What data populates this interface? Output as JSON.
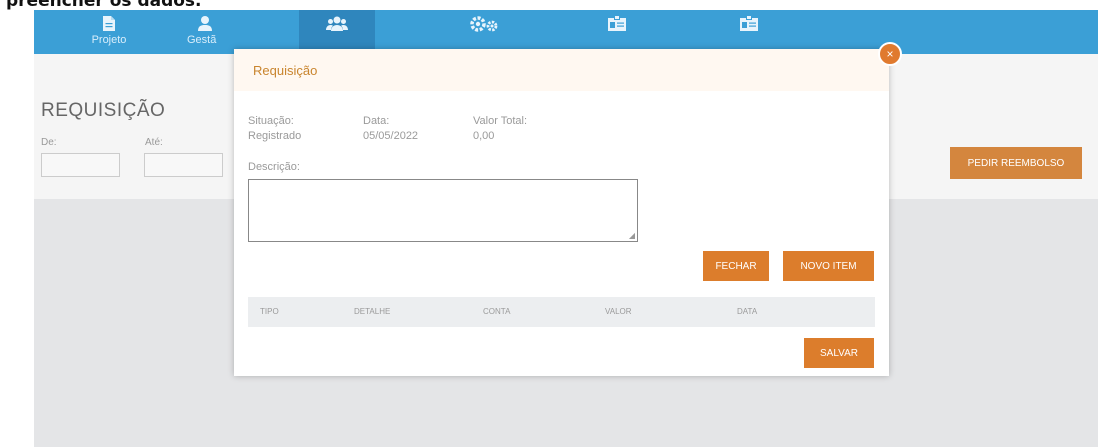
{
  "caption": "preencher os dados.",
  "nav": {
    "items": [
      {
        "label": "Projeto",
        "icon": "document-icon"
      },
      {
        "label": "Gestã",
        "icon": "user-icon"
      },
      {
        "label": "",
        "icon": "group-icon"
      },
      {
        "label": "",
        "icon": "gears-icon"
      },
      {
        "label": "",
        "icon": "id-card-icon"
      },
      {
        "label": "",
        "icon": "id-card-icon"
      }
    ]
  },
  "page": {
    "title": "REQUISIÇÃO",
    "from_label": "De:",
    "to_label": "Até:",
    "reimburse_button": "PEDIR REEMBOLSO"
  },
  "modal": {
    "title": "Requisição",
    "close": "×",
    "situacao_label": "Situação:",
    "situacao_value": "Registrado",
    "data_label": "Data:",
    "data_value": "05/05/2022",
    "valor_label": "Valor Total:",
    "valor_value": "0,00",
    "descricao_label": "Descrição:",
    "fechar_button": "FECHAR",
    "novo_item_button": "NOVO ITEM",
    "columns": [
      "TIPO",
      "DETALHE",
      "CONTA",
      "VALOR",
      "DATA"
    ],
    "salvar_button": "SALVAR"
  },
  "colors": {
    "nav": "#3b9fd6",
    "accent": "#dc7d2c",
    "title": "#c9852e"
  }
}
